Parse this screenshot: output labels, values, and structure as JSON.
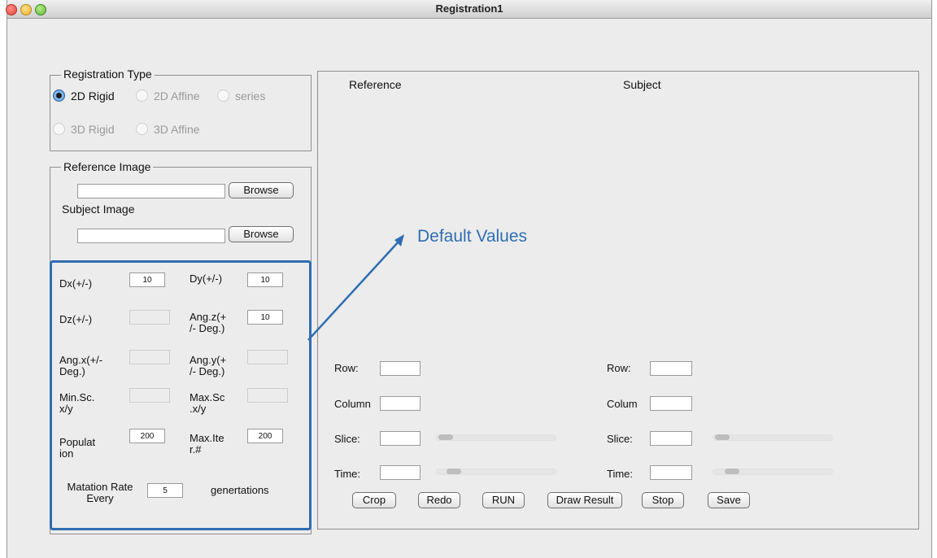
{
  "window": {
    "title": "Registration1"
  },
  "registration_type": {
    "legend": "Registration Type",
    "options": [
      {
        "label": "2D Rigid",
        "selected": true,
        "enabled": true
      },
      {
        "label": "2D Affine",
        "selected": false,
        "enabled": false
      },
      {
        "label": "series",
        "selected": false,
        "enabled": false
      },
      {
        "label": "3D Rigid",
        "selected": false,
        "enabled": false
      },
      {
        "label": "3D Affine",
        "selected": false,
        "enabled": false
      }
    ]
  },
  "images": {
    "reference_legend": "Reference Image",
    "reference_path": "",
    "subject_label": "Subject Image",
    "subject_path": "",
    "browse_label": "Browse"
  },
  "params": {
    "dx_label": "Dx(+/-)",
    "dx_value": "10",
    "dy_label": "Dy(+/-)",
    "dy_value": "10",
    "dz_label": "Dz(+/-)",
    "dz_value": "",
    "angz_label_1": "Ang.z(+",
    "angz_label_2": "/- Deg.)",
    "angz_value": "10",
    "angx_label_1": "Ang.x(+/-",
    "angx_label_2": "Deg.)",
    "angx_value": "",
    "angy_label_1": "Ang.y(+",
    "angy_label_2": "/- Deg.)",
    "angy_value": "",
    "minsc_label_1": "Min.Sc.",
    "minsc_label_2": "x/y",
    "minsc_value": "",
    "maxsc_label_1": "Max.Sc",
    "maxsc_label_2": ".x/y",
    "maxsc_value": "",
    "pop_label_1": "Populat",
    "pop_label_2": "ion",
    "pop_value": "200",
    "maxiter_label_1": "Max.Ite",
    "maxiter_label_2": "r.#",
    "maxiter_value": "200",
    "mut_label_1": "Matation Rate",
    "mut_label_2": "Every",
    "mut_value": "5",
    "mut_suffix": "genertations"
  },
  "viewer": {
    "reference_title": "Reference",
    "subject_title": "Subject",
    "ref": {
      "row_label": "Row:",
      "column_label": "Column",
      "slice_label": "Slice:",
      "time_label": "Time:"
    },
    "subj": {
      "row_label": "Row:",
      "column_label": "Colum",
      "slice_label": "Slice:",
      "time_label": "Time:"
    }
  },
  "actions": {
    "crop": "Crop",
    "redo": "Redo",
    "run": "RUN",
    "draw_result": "Draw Result",
    "stop": "Stop",
    "save": "Save"
  },
  "annotation": {
    "text": "Default Values",
    "color": "#2f6db3"
  }
}
